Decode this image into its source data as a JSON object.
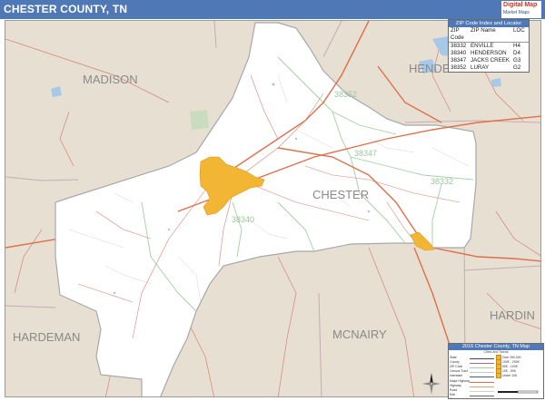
{
  "header": {
    "title": "CHESTER COUNTY, TN"
  },
  "logo": {
    "text": "Digital Map",
    "sub": "Market Maps"
  },
  "map": {
    "region_labels": [
      {
        "name": "county-label-madison",
        "text": "MADISON"
      },
      {
        "name": "county-label-henderson",
        "text": "HENDERSON"
      },
      {
        "name": "county-label-chester",
        "text": "CHESTER"
      },
      {
        "name": "county-label-hardeman",
        "text": "HARDEMAN"
      },
      {
        "name": "county-label-mcnairy",
        "text": "MCNAIRY"
      },
      {
        "name": "county-label-hardin",
        "text": "HARDIN"
      }
    ],
    "zip_labels": [
      {
        "name": "zip-label-38352",
        "text": "38352"
      },
      {
        "name": "zip-label-38347",
        "text": "38347"
      },
      {
        "name": "zip-label-38332",
        "text": "38332"
      },
      {
        "name": "zip-label-38340",
        "text": "38340"
      }
    ],
    "colors": {
      "county_fill": "#ffffff",
      "surround_fill": "#e6dfd2",
      "city_fill": "#f3b534",
      "highway": "#e0704b",
      "zip_boundary": "#9fd19f",
      "water": "#a8c8e8",
      "park": "#c8dcbe"
    }
  },
  "zip_table": {
    "title": "ZIP Code Index and Locator",
    "headers": [
      "ZIP Code",
      "ZIP Name",
      "LOC"
    ],
    "rows": [
      [
        "38332",
        "ENVILLE",
        "H4"
      ],
      [
        "38340",
        "HENDERSON",
        "D4"
      ],
      [
        "38347",
        "JACKS CREEK",
        "G3"
      ],
      [
        "38352",
        "LURAY",
        "G2"
      ]
    ]
  },
  "legend": {
    "title": "2016 Chester County, TN Map",
    "sub": "Cities and Towns",
    "left": [
      "State",
      "County",
      "ZIP Code",
      "Census Tract",
      "Interstate",
      "Major Highway",
      "Highway",
      "Road",
      "Rail",
      "Elevation"
    ],
    "right": [
      "Over 250,000",
      "100K - 250K",
      "50K - 100K",
      "10K - 50K",
      "Under 10K",
      "",
      "",
      "",
      "",
      ""
    ]
  }
}
